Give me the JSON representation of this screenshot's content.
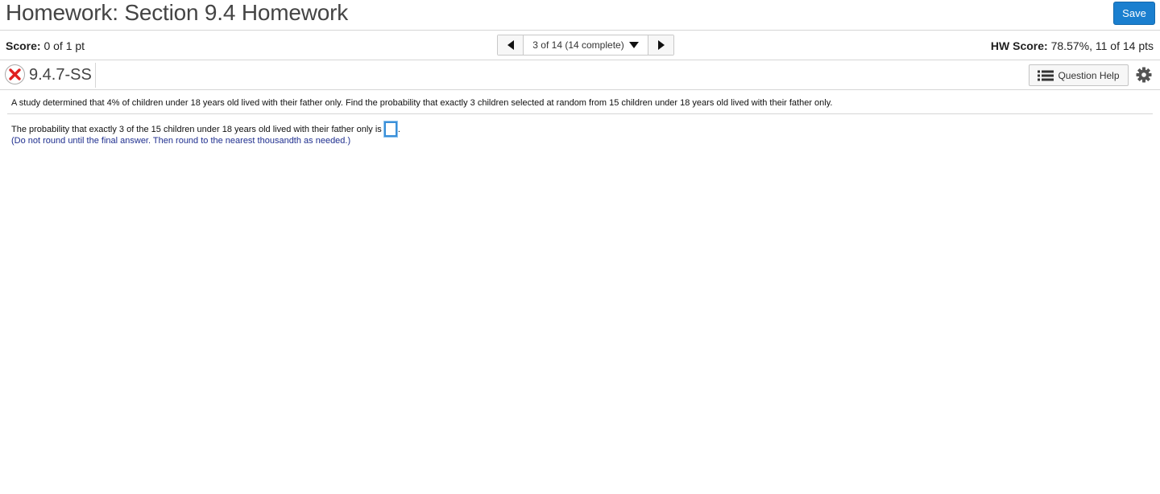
{
  "header": {
    "title": "Homework: Section 9.4 Homework",
    "save_label": "Save",
    "accent_color": "#1a7fcf"
  },
  "score_bar": {
    "score_label": "Score:",
    "score_value": "0 of 1 pt",
    "hw_score_label": "HW Score:",
    "hw_score_value": "78.57%, 11 of 14 pts",
    "nav": {
      "prev_icon": "triangle-left-icon",
      "selector_text": "3 of 14 (14 complete)",
      "selector_icon": "triangle-down-icon",
      "next_icon": "triangle-right-icon"
    }
  },
  "question_bar": {
    "status_icon": "incorrect-x-icon",
    "status_color": "#e02020",
    "question_id": "9.4.7-SS",
    "help_label": "Question Help",
    "help_icon": "list-icon",
    "settings_icon": "gear-icon"
  },
  "question": {
    "problem_text": "A study determined that 4% of children under 18 years old lived with their father only. Find the probability that exactly 3 children selected at random from 15 children under 18 years old lived with their father only.",
    "answer_prefix": "The probability that exactly 3 of the 15 children under 18 years old lived with their father only is",
    "answer_value": "",
    "answer_suffix": ".",
    "instruction": "(Do not round until the final answer. Then round to the nearest thousandth as needed.)"
  }
}
